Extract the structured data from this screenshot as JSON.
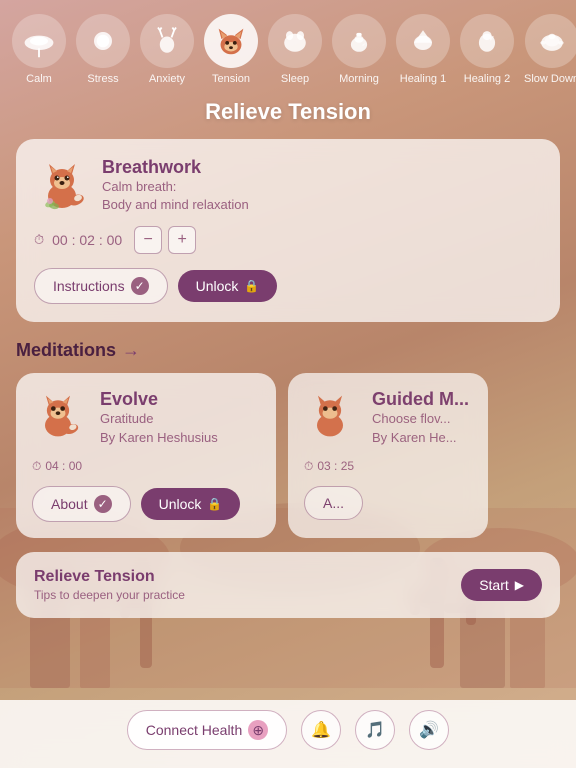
{
  "page": {
    "title": "Relieve Tension"
  },
  "categories": [
    {
      "id": "calm",
      "label": "Calm",
      "active": false,
      "icon": "🐋"
    },
    {
      "id": "stress",
      "label": "Stress",
      "active": false,
      "icon": "🦔"
    },
    {
      "id": "anxiety",
      "label": "Anxiety",
      "active": false,
      "icon": "🦌"
    },
    {
      "id": "tension",
      "label": "Tension",
      "active": true,
      "icon": "🦊"
    },
    {
      "id": "sleep",
      "label": "Sleep",
      "active": false,
      "icon": "🐻"
    },
    {
      "id": "morning",
      "label": "Morning",
      "active": false,
      "icon": "🐓"
    },
    {
      "id": "healing1",
      "label": "Healing 1",
      "active": false,
      "icon": "🦅"
    },
    {
      "id": "healing2",
      "label": "Healing 2",
      "active": false,
      "icon": "🦜"
    },
    {
      "id": "slowdown",
      "label": "Slow Down",
      "active": false,
      "icon": "🐢"
    }
  ],
  "breathwork_card": {
    "title": "Breathwork",
    "subtitle_line1": "Calm breath:",
    "subtitle_line2": "Body and mind relaxation",
    "timer": "00 : 02 : 00",
    "instructions_label": "Instructions",
    "unlock_label": "Unlock"
  },
  "meditations_section": {
    "header": "Meditations",
    "arrow": "→"
  },
  "evolve_card": {
    "title": "Evolve",
    "subtitle_line1": "Gratitude",
    "subtitle_line2": "By Karen Heshusius",
    "time": "04 : 00",
    "about_label": "About",
    "unlock_label": "Unlock"
  },
  "guided_card": {
    "title": "Guided M...",
    "subtitle_line1": "Choose flov...",
    "subtitle_line2": "By Karen He...",
    "time": "03 : 25",
    "about_label": "A..."
  },
  "relieve_card": {
    "title": "Relieve Tension",
    "subtitle": "Tips to deepen your practice",
    "start_label": "Start"
  },
  "bottom_nav": {
    "connect_label": "Connect Health",
    "bell_icon": "🔔",
    "music_icon": "🎵",
    "sound_icon": "🔊"
  },
  "icons": {
    "clock": "⏱",
    "check_circle": "✓",
    "lock": "🔒",
    "play": "▶",
    "minus": "−",
    "plus": "+"
  }
}
